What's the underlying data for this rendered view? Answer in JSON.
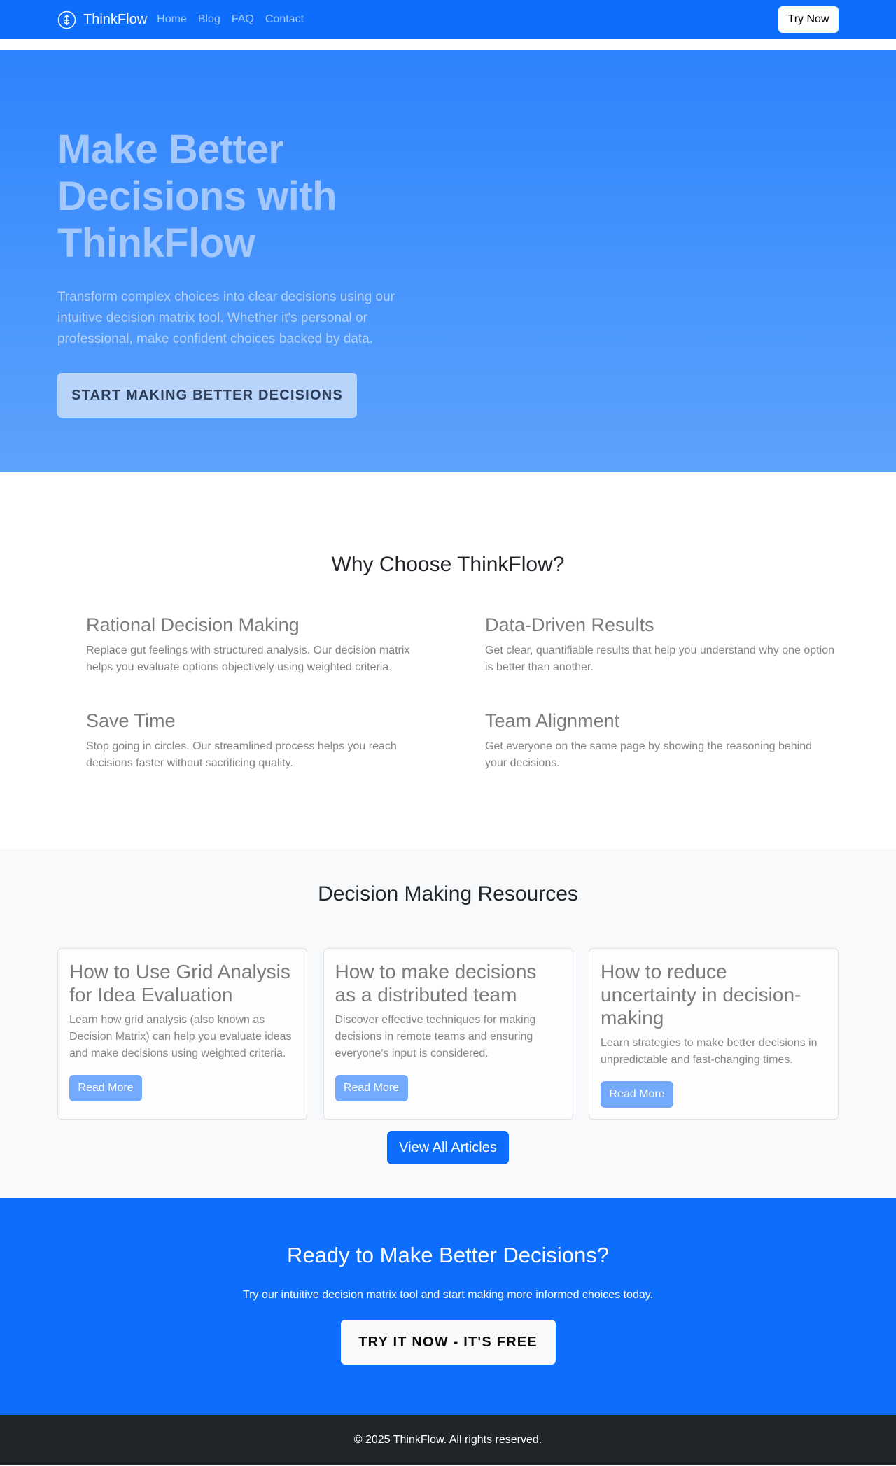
{
  "nav": {
    "brand": "ThinkFlow",
    "links": [
      "Home",
      "Blog",
      "FAQ",
      "Contact"
    ],
    "cta": "Try Now"
  },
  "hero": {
    "title": "Make Better Decisions with ThinkFlow",
    "subtitle": "Transform complex choices into clear decisions using our intuitive decision matrix tool. Whether it's personal or professional, make confident choices backed by data.",
    "button": "START MAKING BETTER DECISIONS"
  },
  "features": {
    "heading": "Why Choose ThinkFlow?",
    "items": [
      {
        "title": "Rational Decision Making",
        "text": "Replace gut feelings with structured analysis. Our decision matrix helps you evaluate options objectively using weighted criteria."
      },
      {
        "title": "Data-Driven Results",
        "text": "Get clear, quantifiable results that help you understand why one option is better than another."
      },
      {
        "title": "Save Time",
        "text": "Stop going in circles. Our streamlined process helps you reach decisions faster without sacrificing quality."
      },
      {
        "title": "Team Alignment",
        "text": "Get everyone on the same page by showing the reasoning behind your decisions."
      }
    ]
  },
  "resources": {
    "heading": "Decision Making Resources",
    "articles": [
      {
        "title": "How to Use Grid Analysis for Idea Evaluation",
        "text": "Learn how grid analysis (also known as Decision Matrix) can help you evaluate ideas and make decisions using weighted criteria.",
        "button": "Read More"
      },
      {
        "title": "How to make decisions as a distributed team",
        "text": "Discover effective techniques for making decisions in remote teams and ensuring everyone's input is considered.",
        "button": "Read More"
      },
      {
        "title": "How to reduce uncertainty in decision-making",
        "text": "Learn strategies to make better decisions in unpredictable and fast-changing times.",
        "button": "Read More"
      }
    ],
    "view_all": "View All Articles"
  },
  "cta": {
    "heading": "Ready to Make Better Decisions?",
    "text": "Try our intuitive decision matrix tool and start making more informed choices today.",
    "button": "TRY IT NOW - IT'S FREE"
  },
  "footer": {
    "copyright": "© 2025 ThinkFlow. All rights reserved."
  },
  "colors": {
    "primary": "#0d6efd",
    "footer_bg": "#212529",
    "section_alt_bg": "#f8f9fa"
  }
}
